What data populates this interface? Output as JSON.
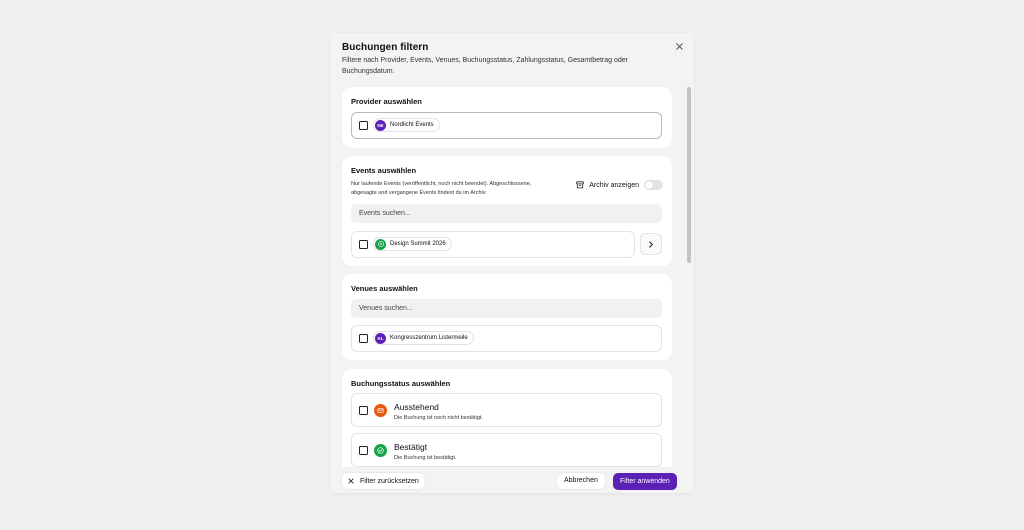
{
  "dialog": {
    "title": "Buchungen filtern",
    "description": "Filtere nach Provider, Events, Venues, Buchungsstatus, Zahlungsstatus, Gesamtbetrag oder Buchungsdatum.",
    "close_icon": "close-icon"
  },
  "provider": {
    "title": "Provider auswählen",
    "items": [
      {
        "initials": "NE",
        "name": "Nordlicht Events",
        "color": "#5b21b6"
      }
    ]
  },
  "events": {
    "title": "Events auswählen",
    "note": "Nur laufende Events (veröffentlicht, noch nicht beendet). Abgeschlossene, abgesagte und vergangene Events findest du im Archiv.",
    "archive_label": "Archiv anzeigen",
    "archive_toggle_on": false,
    "search_placeholder": "Events suchen...",
    "items": [
      {
        "name": "Design Summit 2026",
        "icon": "play-icon",
        "color": "#16a34a"
      }
    ]
  },
  "venues": {
    "title": "Venues auswählen",
    "search_placeholder": "Venues suchen...",
    "items": [
      {
        "initials": "KL",
        "name": "Kongresszentrum Listermeile",
        "color": "#5b21b6"
      }
    ]
  },
  "booking_status": {
    "title": "Buchungsstatus auswählen",
    "items": [
      {
        "title": "Ausstehend",
        "description": "Die Buchung ist noch nicht bestätigt.",
        "icon": "mail-icon",
        "color": "#ea580c"
      },
      {
        "title": "Bestätigt",
        "description": "Die Buchung ist bestätigt.",
        "icon": "check-circle-icon",
        "color": "#16a34a"
      }
    ]
  },
  "footer": {
    "reset_label": "Filter zurücksetzen",
    "cancel_label": "Abbrechen",
    "apply_label": "Filter anwenden"
  },
  "colors": {
    "accent": "#5b21b6",
    "background": "#f0f0f1"
  }
}
